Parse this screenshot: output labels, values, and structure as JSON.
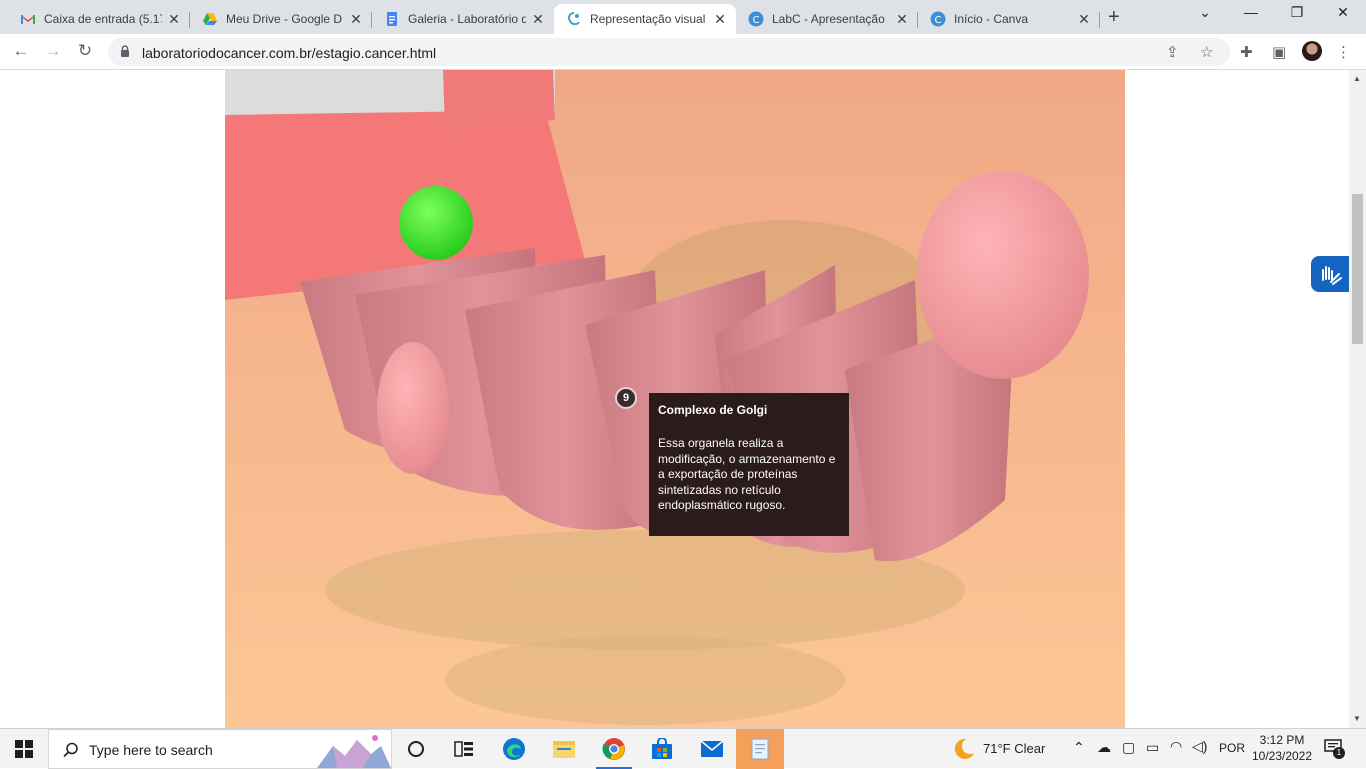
{
  "browser": {
    "tabs": [
      {
        "title": "Caixa de entrada (5.17",
        "favicon": "gmail-icon",
        "active": false
      },
      {
        "title": "Meu Drive - Google D",
        "favicon": "google-drive-icon",
        "active": false
      },
      {
        "title": "Galeria - Laboratório d",
        "favicon": "google-docs-icon",
        "active": false
      },
      {
        "title": "Representação visual d",
        "favicon": "labc-icon",
        "active": true
      },
      {
        "title": "LabC - Apresentação",
        "favicon": "canva-icon",
        "active": false
      },
      {
        "title": "Início - Canva",
        "favicon": "canva-icon",
        "active": false
      }
    ],
    "url": "laboratoriodocancer.com.br/estagio.cancer.html"
  },
  "tooltip": {
    "number": "9",
    "title": "Complexo de Golgi",
    "body": "Essa organela realiza a modificação, o armazenamento e a exportação de proteínas sintetizadas no retículo endoplasmático rugoso."
  },
  "taskbar": {
    "search_placeholder": "Type here to search",
    "weather": "71°F  Clear",
    "language": "POR",
    "time": "3:12 PM",
    "date": "10/23/2022",
    "notification_count": "1"
  },
  "colors": {
    "accent": "#1a73e8",
    "vlibras": "#1565c0",
    "tooltip_bg": "#2b1b1c"
  }
}
